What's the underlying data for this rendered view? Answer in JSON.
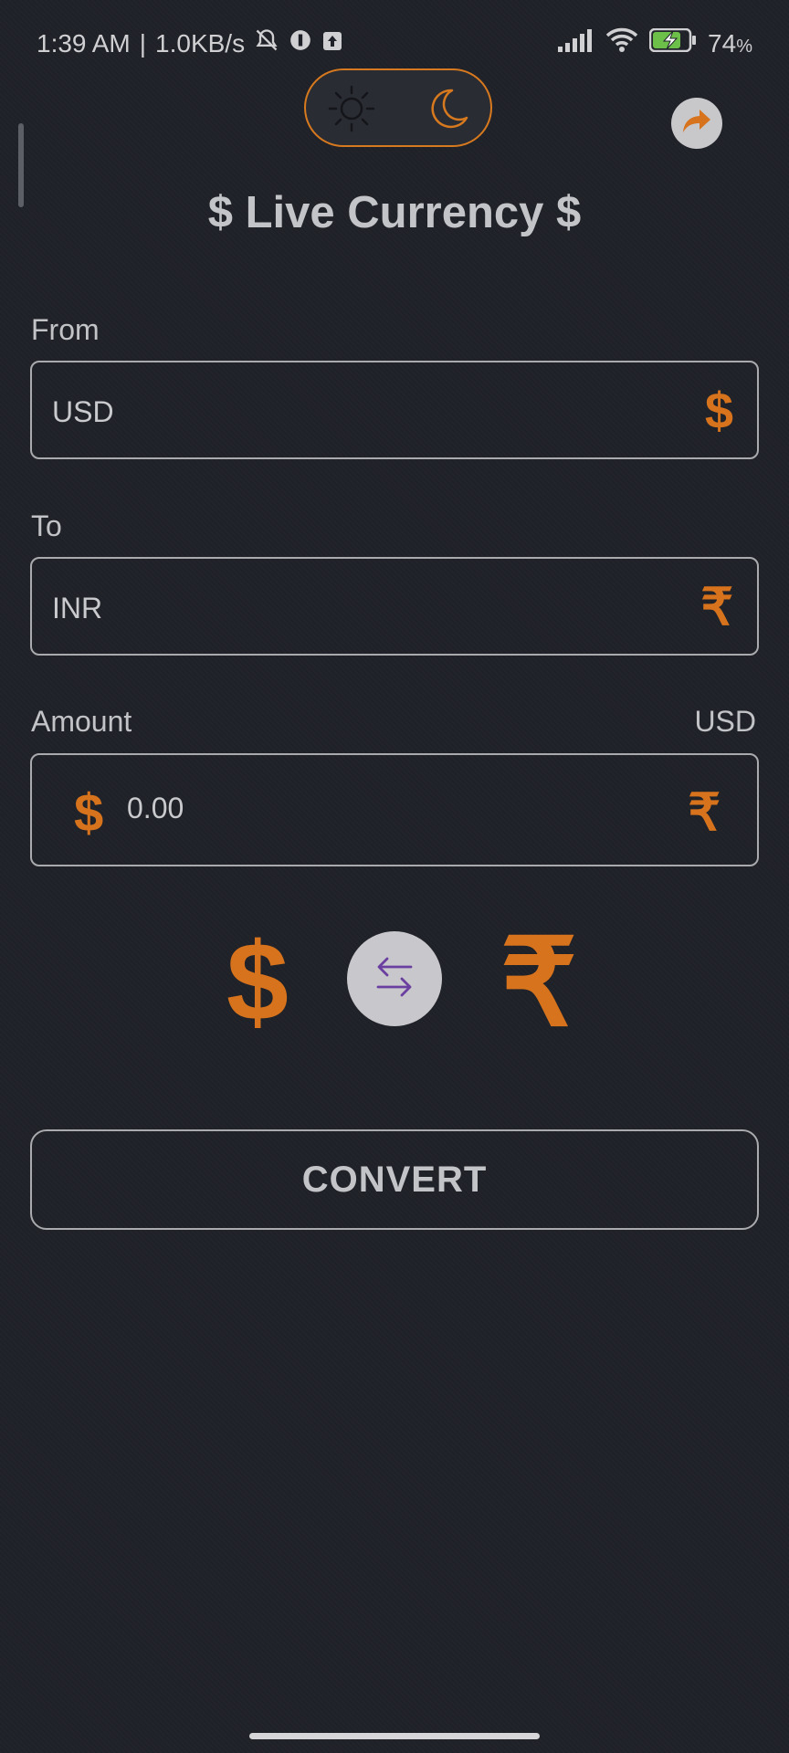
{
  "status_bar": {
    "time": "1:39 AM",
    "network_speed": "1.0KB/s",
    "battery_percent": "74",
    "battery_suffix": "%",
    "icons": [
      "muted-bell-icon",
      "circle-app-icon",
      "upload-icon",
      "signal-icon",
      "wifi-icon",
      "battery-charging-icon"
    ]
  },
  "theme_toggle": {
    "options": [
      "light",
      "dark"
    ],
    "selected": "dark",
    "accent": "#d7791e"
  },
  "header": {
    "title": "$ Live Currency $"
  },
  "from": {
    "label": "From",
    "value": "USD",
    "icon": "$"
  },
  "to": {
    "label": "To",
    "value": "INR",
    "icon": "₹"
  },
  "amount": {
    "label": "Amount",
    "unit": "USD",
    "value": "0.00",
    "start_icon": "$",
    "end_icon": "₹"
  },
  "swap_row": {
    "from_symbol": "$",
    "to_symbol": "₹",
    "swap_icon": "swap-arrows-icon"
  },
  "convert_button": {
    "label": "CONVERT"
  },
  "colors": {
    "background": "#1f2128",
    "accent": "#d7731c",
    "swap_arrow": "#6b3fa0"
  }
}
